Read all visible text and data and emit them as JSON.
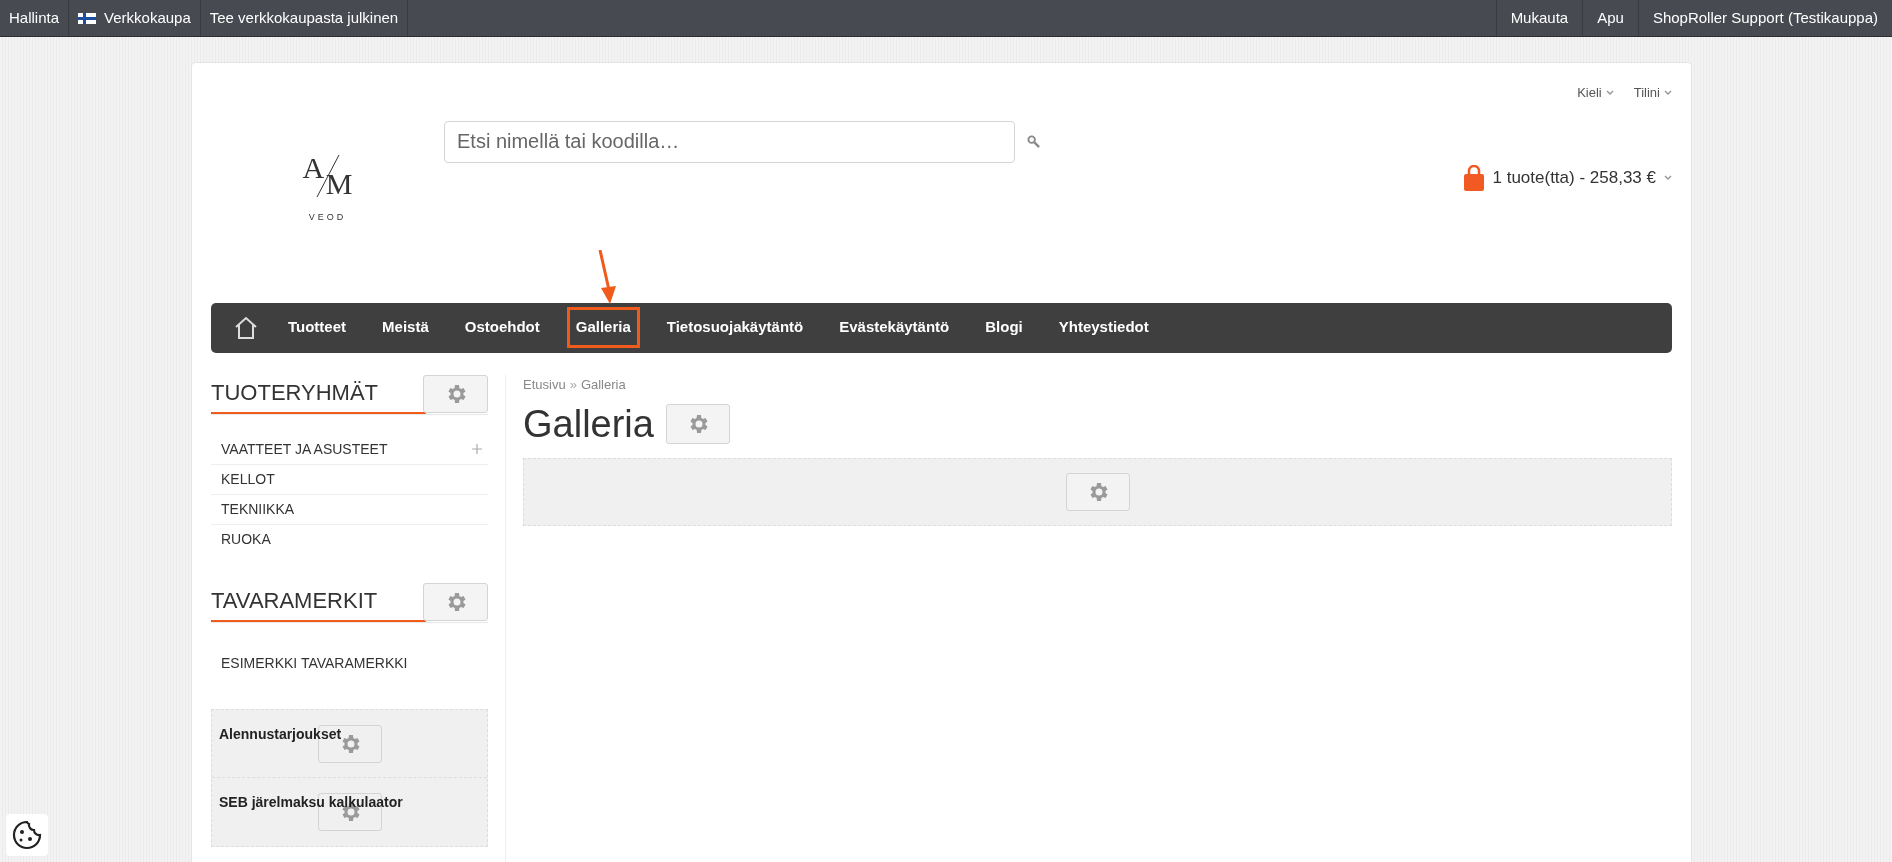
{
  "admin_bar": {
    "left": [
      {
        "label": "Hallinta",
        "flag": false
      },
      {
        "label": "Verkkokaupa",
        "flag": true
      },
      {
        "label": "Tee verkkokaupasta julkinen",
        "flag": false
      }
    ],
    "right": [
      "Mukauta",
      "Apu",
      "ShopRoller Support (Testikauppa)"
    ]
  },
  "header": {
    "logo": {
      "mark_top": "A",
      "mark_bottom": "M",
      "name": "VEOD"
    },
    "search": {
      "placeholder": "Etsi nimellä tai koodilla…"
    },
    "menus": [
      "Kieli",
      "Tilini"
    ],
    "cart": "1 tuote(tta) - 258,33 €"
  },
  "nav": {
    "items": [
      {
        "label": "Tuotteet",
        "selected": false
      },
      {
        "label": "Meistä",
        "selected": false
      },
      {
        "label": "Ostoehdot",
        "selected": false
      },
      {
        "label": "Galleria",
        "selected": true
      },
      {
        "label": "Tietosuojakäytäntö",
        "selected": false
      },
      {
        "label": "Evästekäytäntö",
        "selected": false
      },
      {
        "label": "Blogi",
        "selected": false
      },
      {
        "label": "Yhteystiedot",
        "selected": false
      }
    ]
  },
  "sidebar": {
    "sections": [
      {
        "title": "TUOTERYHMÄT",
        "items": [
          {
            "label": "VAATTEET JA ASUSTEET",
            "expandable": true
          },
          {
            "label": "KELLOT",
            "expandable": false
          },
          {
            "label": "TEKNIIKKA",
            "expandable": false
          },
          {
            "label": "RUOKA",
            "expandable": false
          }
        ]
      },
      {
        "title": "TAVARAMERKIT",
        "items": [
          {
            "label": "ESIMERKKI TAVARAMERKKI",
            "expandable": false
          }
        ]
      }
    ],
    "widgets": [
      "Alennustarjoukset",
      "SEB järelmaksu kalkulaator"
    ]
  },
  "breadcrumb": {
    "items": [
      "Etusivu",
      "Galleria"
    ],
    "separator": "»"
  },
  "page_title": "Galleria"
}
